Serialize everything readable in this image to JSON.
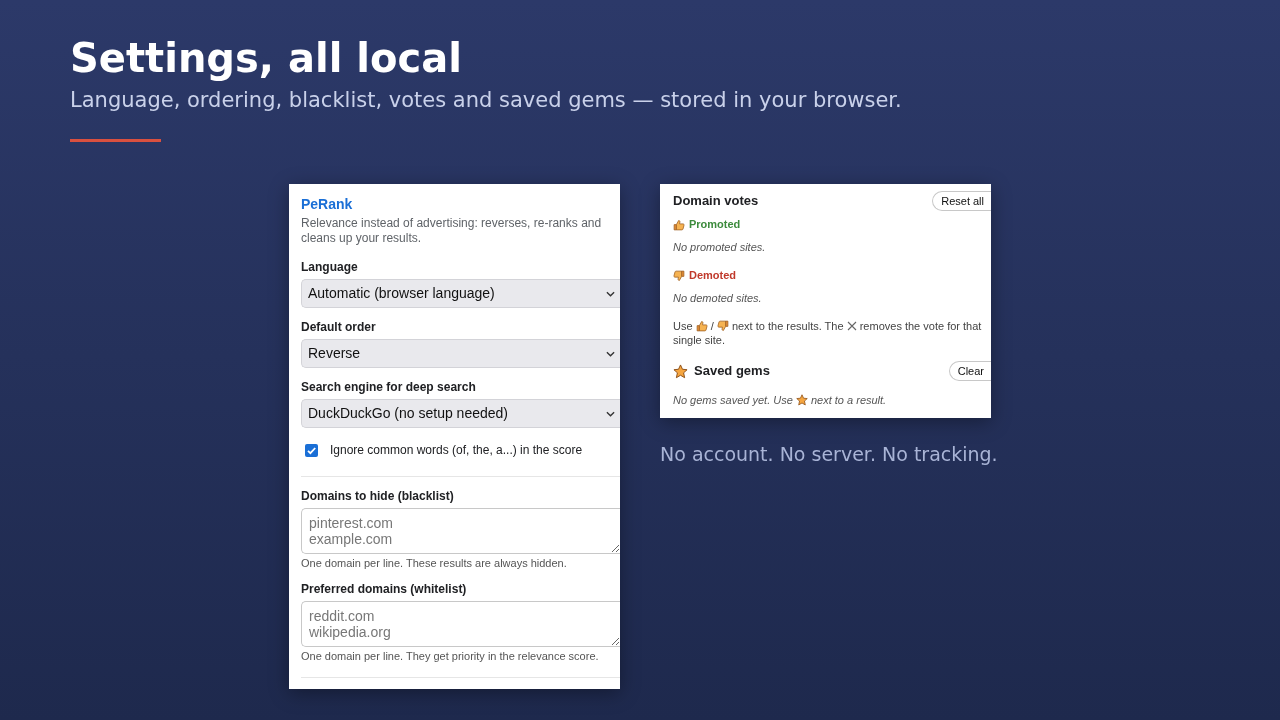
{
  "slide": {
    "title": "Settings, all local",
    "subtitle": "Language, ordering, blacklist, votes and saved gems — stored in your browser.",
    "caption": "No account. No server. No tracking."
  },
  "settings_panel": {
    "title": "PeRank",
    "description": "Relevance instead of advertising: reverses, re-ranks and cleans up your results.",
    "fields": [
      {
        "kind": "select",
        "label": "Language",
        "value": "Automatic (browser language)"
      },
      {
        "kind": "select",
        "label": "Default order",
        "value": "Reverse"
      },
      {
        "kind": "select",
        "label": "Search engine for deep search",
        "value": "DuckDuckGo (no setup needed)"
      },
      {
        "kind": "checkbox",
        "label": "Ignore common words (of, the, a...) in the score",
        "checked": true
      },
      {
        "kind": "textarea",
        "label": "Domains to hide (blacklist)",
        "placeholder": "pinterest.com\nexample.com",
        "hint": "One domain per line. These results are always hidden."
      },
      {
        "kind": "textarea",
        "label": "Preferred domains (whitelist)",
        "placeholder": "reddit.com\nwikipedia.org",
        "hint": "One domain per line. They get priority in the relevance score."
      }
    ]
  },
  "votes_panel": {
    "title": "Domain votes",
    "reset_button": "Reset all",
    "groups": [
      {
        "kind": "promoted",
        "label": "Promoted",
        "empty_text": "No promoted sites."
      },
      {
        "kind": "demoted",
        "label": "Demoted",
        "empty_text": "No demoted sites."
      }
    ],
    "help": [
      {
        "kind": "text",
        "text": "Use"
      },
      {
        "kind": "thumbs_up"
      },
      {
        "kind": "text",
        "text": "/"
      },
      {
        "kind": "thumbs_down"
      },
      {
        "kind": "text",
        "text": "next to the results. The"
      },
      {
        "kind": "cross"
      },
      {
        "kind": "text",
        "text": "removes the vote for that"
      },
      {
        "kind": "text",
        "text": "single site."
      }
    ],
    "gems": {
      "title": "Saved gems",
      "clear_button": "Clear",
      "empty_text": [
        {
          "kind": "text",
          "text": "No gems saved yet. Use"
        },
        {
          "kind": "star"
        },
        {
          "kind": "text",
          "text": "next to a result."
        }
      ]
    }
  }
}
